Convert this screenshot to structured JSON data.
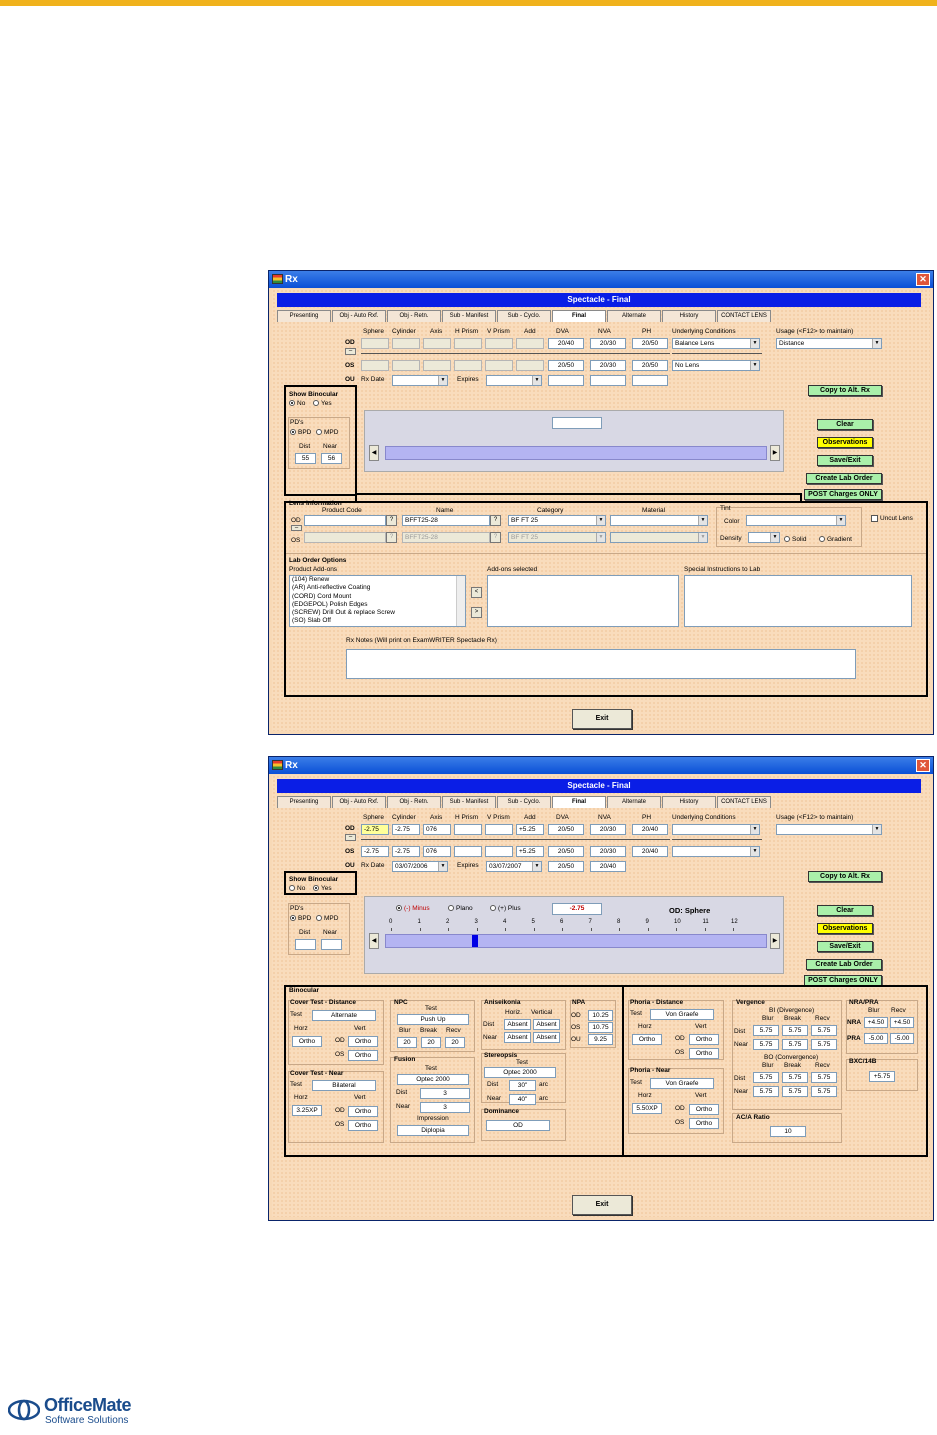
{
  "window_title": "Rx",
  "header": "Spectacle - Final",
  "tabs": [
    "Presenting",
    "Obj - Auto Rxf.",
    "Obj - Retn.",
    "Sub - Manifest",
    "Sub - Cyclo.",
    "Final",
    "Alternate",
    "History",
    "CONTACT LENS"
  ],
  "cols": {
    "sphere": "Sphere",
    "cylinder": "Cylinder",
    "axis": "Axis",
    "hprism": "H Prism",
    "vprism": "V Prism",
    "add": "Add",
    "dva": "DVA",
    "nva": "NVA",
    "ph": "PH",
    "underlying": "Underlying Conditions",
    "usage": "Usage (<F12> to maintain)"
  },
  "rows": {
    "od": "OD",
    "os": "OS",
    "ou": "OU",
    "rxdate": "Rx Date",
    "expires": "Expires"
  },
  "buttons": {
    "copy": "Copy to Alt. Rx",
    "clear": "Clear",
    "observations": "Observations",
    "save": "Save/Exit",
    "lab": "Create Lab Order",
    "post": "POST Charges ONLY",
    "exit": "Exit"
  },
  "showbin": {
    "title": "Show Binocular",
    "no": "No",
    "yes": "Yes"
  },
  "pd": {
    "title": "PD's",
    "bpd": "BPD",
    "mpd": "MPD",
    "dist": "Dist",
    "near": "Near"
  },
  "top": {
    "od": {
      "dva": "20/40",
      "nva": "20/30",
      "ph": "20/50",
      "underlying": "Balance Lens",
      "usage": "Distance"
    },
    "os": {
      "dva": "20/50",
      "nva": "20/30",
      "ph": "20/50",
      "underlying": "No Lens"
    },
    "pd_dist": "55",
    "pd_near": "56",
    "lens": {
      "title": "Lens Information",
      "product_code": "Product Code",
      "name": "Name",
      "category": "Category",
      "material": "Material",
      "tint": "Tint",
      "color": "Color",
      "density": "Density",
      "solid": "Solid",
      "gradient": "Gradient",
      "uncut": "Uncut Lens",
      "od_name": "BFFT25-28",
      "od_category": "BF FT 25",
      "os_name": "BFFT25-28",
      "os_category": "BF FT 25"
    },
    "lab": {
      "title": "Lab Order Options",
      "addons": "Product Add-ons",
      "selected": "Add-ons selected",
      "special": "Special Instructions to Lab",
      "items": [
        "(104) Renew",
        "(AR) Anti-reflective Coating",
        "(CORD) Cord Mount",
        "(EDGEPOL) Polish Edges",
        "(SCREW) Drill Out & replace Screw",
        "(SO) Slab Off"
      ],
      "notes": "Rx Notes (Will print on ExamWRITER Spectacle Rx)"
    }
  },
  "bottom": {
    "od": {
      "sphere": "-2.75",
      "cylinder": "-2.75",
      "axis": "076",
      "add": "+5.25",
      "dva": "20/50",
      "nva": "20/30",
      "ph": "20/40"
    },
    "os": {
      "sphere": "-2.75",
      "cylinder": "-2.75",
      "axis": "076",
      "add": "+5.25",
      "dva": "20/50",
      "nva": "20/30",
      "ph": "20/40"
    },
    "ou": {
      "rxdate": "03/07/2006",
      "expires": "03/07/2007",
      "dva": "20/50",
      "nva": "20/40"
    },
    "slider": {
      "minus": "(-) Minus",
      "plano": "Plano",
      "plus": "(+) Plus",
      "value": "-2.75",
      "label": "OD: Sphere",
      "ticks": [
        "0",
        "1",
        "2",
        "3",
        "4",
        "5",
        "6",
        "7",
        "8",
        "9",
        "10",
        "11",
        "12"
      ]
    },
    "binocular": {
      "title": "Binocular",
      "ct_dist": {
        "title": "Cover Test - Distance",
        "test_label": "Test",
        "test": "Alternate",
        "horz_label": "Horz",
        "vert_label": "Vert",
        "horz": "Ortho",
        "od": "Ortho",
        "os": "Ortho"
      },
      "ct_near": {
        "title": "Cover Test - Near",
        "test_label": "Test",
        "test": "Bilateral",
        "horz_label": "Horz",
        "vert_label": "Vert",
        "horz": "3.25XP",
        "od": "Ortho",
        "os": "Ortho"
      },
      "npc": {
        "title": "NPC",
        "test_label": "Test",
        "test": "Push Up",
        "blur_label": "Blur",
        "break_label": "Break",
        "recv_label": "Recv",
        "blur": "20",
        "break": "20",
        "recv": "20"
      },
      "fusion": {
        "title": "Fusion",
        "test_label": "Test",
        "test": "Optec 2000",
        "dist_label": "Dist",
        "near_label": "Near",
        "dist": "3",
        "near": "3",
        "impression_label": "Impression",
        "impression": "Diplopia"
      },
      "aniseikonia": {
        "title": "Aniseikonia",
        "horz_label": "Horiz.",
        "vert_label": "Vertical",
        "dist_label": "Dist",
        "near_label": "Near",
        "dist_h": "Absent",
        "dist_v": "Absent",
        "near_h": "Absent",
        "near_v": "Absent"
      },
      "stereopsis": {
        "title": "Stereopsis",
        "test_label": "Test",
        "test": "Optec 2000",
        "dist_label": "Dist",
        "near_label": "Near",
        "dist": "30\"",
        "near": "40\"",
        "arc": "arc"
      },
      "dominance": {
        "title": "Dominance",
        "value": "OD"
      },
      "npa": {
        "title": "NPA",
        "od": "10.25",
        "os": "10.75",
        "ou": "9.25"
      },
      "phoria_dist": {
        "title": "Phoria - Distance",
        "test_label": "Test",
        "test": "Von Graefe",
        "horz_label": "Horz",
        "vert_label": "Vert",
        "horz": "Ortho",
        "od": "Ortho",
        "os": "Ortho"
      },
      "phoria_near": {
        "title": "Phoria - Near",
        "test_label": "Test",
        "test": "Von Graefe",
        "horz_label": "Horz",
        "vert_label": "Vert",
        "horz": "5.50XP",
        "od": "Ortho",
        "os": "Ortho"
      },
      "vergence": {
        "title": "Vergence",
        "bi": "BI (Divergence)",
        "bo": "BO (Convergence)",
        "blur_label": "Blur",
        "break_label": "Break",
        "recv_label": "Recv",
        "dist_label": "Dist",
        "near_label": "Near",
        "value": "5.75"
      },
      "aca": {
        "title": "AC/A Ratio",
        "value": "10"
      },
      "nrapra": {
        "title": "NRA/PRA",
        "blur_label": "Blur",
        "recv_label": "Recv",
        "nra_label": "NRA",
        "pra_label": "PRA",
        "nra_blur": "+4.50",
        "nra_recv": "+4.50",
        "pra_blur": "-5.00",
        "pra_recv": "-5.00"
      },
      "bxc": {
        "title": "BXC/14B",
        "value": "+5.75"
      }
    }
  },
  "logo": {
    "name": "OfficeMate",
    "sub": "Software Solutions",
    "color": "#1a4c8c"
  }
}
